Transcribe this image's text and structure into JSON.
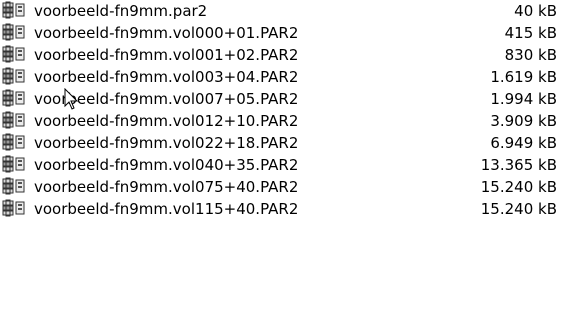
{
  "files": [
    {
      "name": "voorbeeld-fn9mm.par2",
      "size": "40 kB",
      "icon": "winrar-archive-icon"
    },
    {
      "name": "voorbeeld-fn9mm.vol000+01.PAR2",
      "size": "415 kB",
      "icon": "winrar-archive-icon"
    },
    {
      "name": "voorbeeld-fn9mm.vol001+02.PAR2",
      "size": "830 kB",
      "icon": "winrar-archive-icon"
    },
    {
      "name": "voorbeeld-fn9mm.vol003+04.PAR2",
      "size": "1.619 kB",
      "icon": "winrar-archive-icon"
    },
    {
      "name": "voorbeeld-fn9mm.vol007+05.PAR2",
      "size": "1.994 kB",
      "icon": "winrar-archive-icon"
    },
    {
      "name": "voorbeeld-fn9mm.vol012+10.PAR2",
      "size": "3.909 kB",
      "icon": "winrar-archive-icon"
    },
    {
      "name": "voorbeeld-fn9mm.vol022+18.PAR2",
      "size": "6.949 kB",
      "icon": "winrar-archive-icon"
    },
    {
      "name": "voorbeeld-fn9mm.vol040+35.PAR2",
      "size": "13.365 kB",
      "icon": "winrar-archive-icon"
    },
    {
      "name": "voorbeeld-fn9mm.vol075+40.PAR2",
      "size": "15.240 kB",
      "icon": "winrar-archive-icon"
    },
    {
      "name": "voorbeeld-fn9mm.vol115+40.PAR2",
      "size": "15.240 kB",
      "icon": "winrar-archive-icon"
    }
  ],
  "cursor_icon": "mouse-pointer-icon"
}
